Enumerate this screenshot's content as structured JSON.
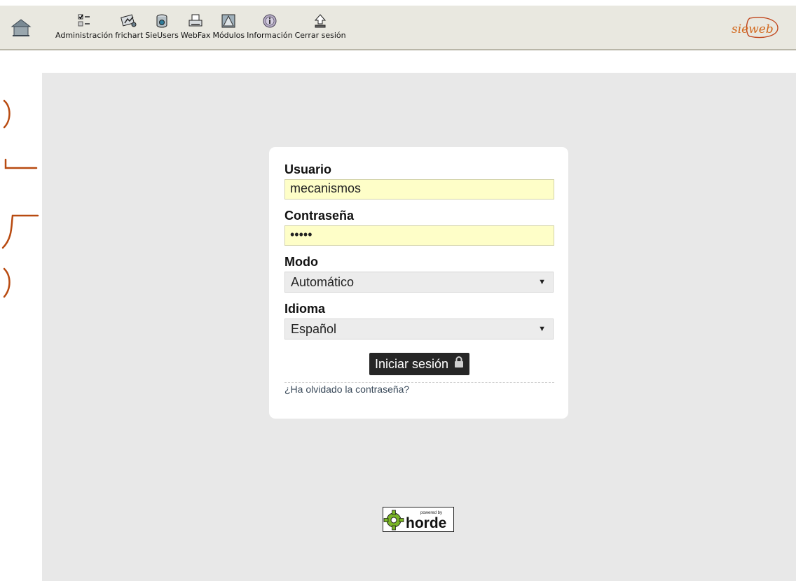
{
  "toolbar": {
    "items": [
      {
        "label": "Administración",
        "icon": "checklist-icon"
      },
      {
        "label": "frichart",
        "icon": "chart-tools-icon"
      },
      {
        "label": "SieUsers",
        "icon": "database-icon"
      },
      {
        "label": "WebFax",
        "icon": "fax-icon"
      },
      {
        "label": "Módulos",
        "icon": "modules-icon"
      },
      {
        "label": "Información",
        "icon": "info-icon"
      },
      {
        "label": "Cerrar sesión",
        "icon": "logout-icon"
      }
    ],
    "brand": "sieweb"
  },
  "login": {
    "user_label": "Usuario",
    "user_value": "mecanismos",
    "password_label": "Contraseña",
    "password_value": "•••••",
    "mode_label": "Modo",
    "mode_value": "Automático",
    "language_label": "Idioma",
    "language_value": "Español",
    "submit_label": "Iniciar sesión",
    "forgot_label": "¿Ha olvidado la contraseña?"
  },
  "footer": {
    "powered_by": "powered by",
    "horde": "horde"
  },
  "colors": {
    "toolbar_bg": "#e9e8e0",
    "main_bg": "#e8e8e8",
    "input_bg": "#fefec8",
    "button_bg": "#262626",
    "brand_orange": "#d2691e",
    "mark_color": "#b84a10",
    "horde_green": "#7ab526"
  }
}
